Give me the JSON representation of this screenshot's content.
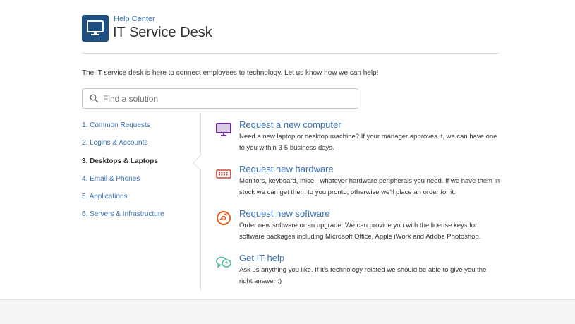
{
  "header": {
    "help_center": "Help Center",
    "title": "IT Service Desk"
  },
  "intro": "The IT service desk is here to connect employees to technology. Let us know how we can help!",
  "search": {
    "placeholder": "Find a solution",
    "value": ""
  },
  "categories": [
    {
      "label": "1. Common Requests",
      "active": false
    },
    {
      "label": "2. Logins & Accounts",
      "active": false
    },
    {
      "label": "3. Desktops & Laptops",
      "active": true
    },
    {
      "label": "4. Email & Phones",
      "active": false
    },
    {
      "label": "5. Applications",
      "active": false
    },
    {
      "label": "6. Servers & Infrastructure",
      "active": false
    }
  ],
  "requests": [
    {
      "title": "Request a new computer",
      "description": "Need a new laptop or desktop machine? If your manager approves it, we can have one to you within 3-5 business days.",
      "icon": "monitor-icon",
      "color": "#6b2c91"
    },
    {
      "title": "Request new hardware",
      "description": "Monitors, keyboard, mice - whatever hardware peripherals you need. If we have them in stock we can get them to you pronto, otherwise we'll place an order for it.",
      "icon": "keyboard-icon",
      "color": "#d04437"
    },
    {
      "title": "Request new software",
      "description": "Order new software or an upgrade. We can provide you with the license keys for software packages including Microsoft Office, Apple iWork and Adobe Photoshop.",
      "icon": "software-disc-icon",
      "color": "#e55c1f"
    },
    {
      "title": "Get IT help",
      "description": "Ask us anything you like. If it's technology related we should be able to give you the right answer :)",
      "icon": "chat-help-icon",
      "color": "#59b795"
    }
  ],
  "colors": {
    "brand": "#205081",
    "link": "#3b73af"
  }
}
